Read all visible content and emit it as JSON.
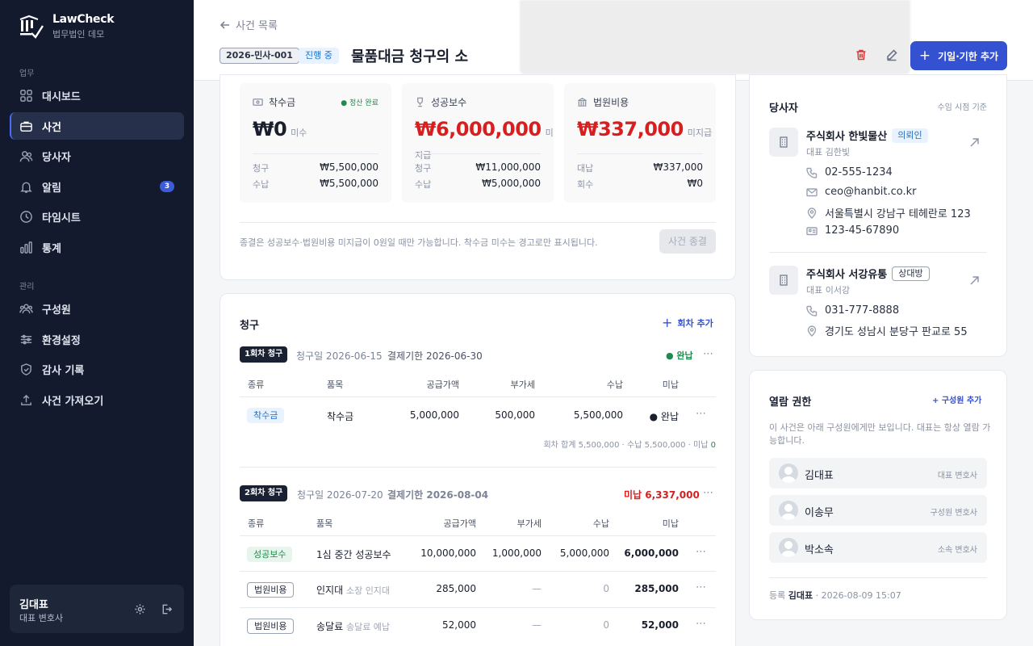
{
  "app": {
    "name": "LawCheck",
    "org": "법무법인 데모"
  },
  "sidebar": {
    "section_work": "업무",
    "section_admin": "관리",
    "items": [
      {
        "label": "대시보드",
        "icon": "grid-icon"
      },
      {
        "label": "사건",
        "icon": "briefcase-icon",
        "active": true
      },
      {
        "label": "당사자",
        "icon": "users-icon"
      },
      {
        "label": "알림",
        "icon": "bell-icon",
        "badge": "3"
      },
      {
        "label": "타임시트",
        "icon": "clock-icon"
      },
      {
        "label": "통계",
        "icon": "bar-chart-icon"
      }
    ],
    "admin_items": [
      {
        "label": "구성원",
        "icon": "team-icon"
      },
      {
        "label": "환경설정",
        "icon": "sliders-icon"
      },
      {
        "label": "감사 기록",
        "icon": "shield-icon"
      },
      {
        "label": "사건 가져오기",
        "icon": "upload-icon"
      }
    ],
    "user": {
      "name": "김대표",
      "role": "대표 변호사"
    }
  },
  "header": {
    "back_label": "사건 목록",
    "case_no": "2026-민사-001",
    "status": "진행 중",
    "title": "물품대금 청구의 소",
    "add_button": "기일·기한 추가"
  },
  "finance": {
    "retainer": {
      "label": "착수금",
      "status": "● 정산 완료",
      "amount": "₩0",
      "note": "미수",
      "billed_label": "청구",
      "billed": "₩5,500,000",
      "paid_label": "수납",
      "paid": "₩5,500,000"
    },
    "success_fee": {
      "label": "성공보수",
      "amount": "₩6,000,000",
      "note": "미지급",
      "billed_label": "청구",
      "billed": "₩11,000,000",
      "paid_label": "수납",
      "paid": "₩5,000,000"
    },
    "court_cost": {
      "label": "법원비용",
      "amount": "₩337,000",
      "note": "미지급",
      "billed_label": "대납",
      "billed": "₩337,000",
      "paid_label": "회수",
      "paid": "₩0"
    },
    "close_note": "종결은 성공보수·법원비용 미지급이 0원일 때만 가능합니다. 착수금 미수는 경고로만 표시됩니다.",
    "close_button": "사건 종결"
  },
  "billing": {
    "title": "청구",
    "add_round": "회차 추가",
    "columns": {
      "type": "종류",
      "item": "품목",
      "supply": "공급가액",
      "vat": "부가세",
      "paid": "수납",
      "unpaid": "미납"
    },
    "invoices": [
      {
        "tag": "1회차 청구",
        "billed_date": "청구일 2026-06-15",
        "due": "결제기한 2026-06-30",
        "state": "● 완납",
        "rows": [
          {
            "type": "착수금",
            "item": "착수금",
            "sub": "",
            "supply": "5,000,000",
            "vat": "500,000",
            "paid": "5,500,000",
            "unpaid": "● 완납"
          }
        ],
        "summary_a": "회차 합계 5,500,000 · 수납 5,500,000 · 미납 ",
        "summary_b": "0"
      },
      {
        "tag": "2회차 청구",
        "billed_date": "청구일 2026-07-20",
        "due": "결제기한 2026-08-04",
        "state": "미납 6,337,000",
        "rows": [
          {
            "type": "성공보수",
            "item": "1심 중간 성공보수",
            "sub": "",
            "supply": "10,000,000",
            "vat": "1,000,000",
            "paid": "5,000,000",
            "unpaid": "6,000,000"
          },
          {
            "type": "법원비용",
            "item": "인지대",
            "sub": "소장 인지대",
            "supply": "285,000",
            "vat": "—",
            "paid": "0",
            "unpaid": "285,000"
          },
          {
            "type": "법원비용",
            "item": "송달료",
            "sub": "송달료 예납",
            "supply": "52,000",
            "vat": "—",
            "paid": "0",
            "unpaid": "52,000"
          }
        ]
      }
    ]
  },
  "parties": {
    "title": "당사자",
    "basis": "수임 시점 기준",
    "list": [
      {
        "name": "주식회사 한빛물산",
        "tag": "의뢰인",
        "rep": "대표 김한빛",
        "phone": "02-555-1234",
        "email": "ceo@hanbit.co.kr",
        "address": "서울특별시 강남구 테헤란로 123",
        "bizno": "123-45-67890"
      },
      {
        "name": "주식회사 서강유통",
        "tag": "상대방",
        "rep": "대표 이서강",
        "phone": "031-777-8888",
        "address": "경기도 성남시 분당구 판교로 55"
      }
    ]
  },
  "access": {
    "title": "열람 권한",
    "add": "+ 구성원 추가",
    "desc": "이 사건은 아래 구성원에게만 보입니다. 대표는 항상 열람 가능합니다.",
    "members": [
      {
        "name": "김대표",
        "role": "대표 변호사"
      },
      {
        "name": "이송무",
        "role": "구성원 변호사"
      },
      {
        "name": "박소속",
        "role": "소속 변호사"
      }
    ],
    "registered_prefix": "등록 ",
    "registered_by": "김대표",
    "registered_at": " · 2026-08-09 15:07"
  },
  "colors": {
    "accent": "#3451d1",
    "sidebar": "#131a2e",
    "danger": "#d81e1e",
    "success": "#1f8a4c"
  }
}
